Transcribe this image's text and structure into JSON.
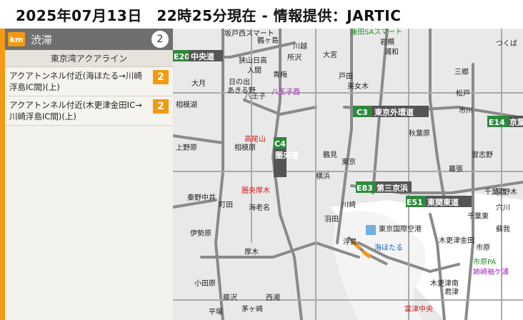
{
  "header": {
    "title": "2025年07月13日　22時25分現在 - 情報提供：JARTIC"
  },
  "panel": {
    "unit_badge": "km",
    "title": "渋滞",
    "count": "2",
    "route": "東京湾アクアライン",
    "items": [
      {
        "text": "アクアトンネル付近(海ほたる→川崎浮島IC間)(上)",
        "value": "2"
      },
      {
        "text": "アクアトンネル付近(木更津金田IC→川崎浮島IC間)(上)",
        "value": "2"
      }
    ]
  },
  "map": {
    "shields": [
      {
        "code": "E20",
        "name": "中央道"
      },
      {
        "code": "C3",
        "name": "東京外環道"
      },
      {
        "code": "E14",
        "name": "京葉"
      },
      {
        "code": "C4",
        "name": "圏央道"
      },
      {
        "code": "E83",
        "name": "第三京浜"
      },
      {
        "code": "E51",
        "name": "東関東道"
      }
    ],
    "labels": [
      "坂戸西スマート",
      "蓮田SAスマート",
      "岩槻",
      "浦和",
      "鶴ヶ島",
      "川越",
      "狭山日高",
      "入間",
      "青梅",
      "日の出",
      "あきる野",
      "八王子西",
      "八王子",
      "相模湖",
      "上野原",
      "大月",
      "高尾山",
      "相模原",
      "圏央厚木",
      "海老名",
      "厚木",
      "伊勢原",
      "秦野中井",
      "東京",
      "羽田",
      "川崎",
      "浮島",
      "海ほたる",
      "東京国際空港",
      "木更津金田",
      "木更津南",
      "君津",
      "富津中央",
      "市原",
      "千葉東",
      "千葉北",
      "幕張",
      "松戸",
      "三郷",
      "市川",
      "習志野",
      "宮野木",
      "穴川",
      "蘇我",
      "大宮",
      "所沢",
      "戸田",
      "美女木",
      "市原PA",
      "姉崎袖ケ浦",
      "鶴見",
      "横浜",
      "町田",
      "藤沢",
      "茅ヶ崎",
      "平塚",
      "小田原",
      "西湘",
      "秋葉原",
      "つくば"
    ]
  }
}
